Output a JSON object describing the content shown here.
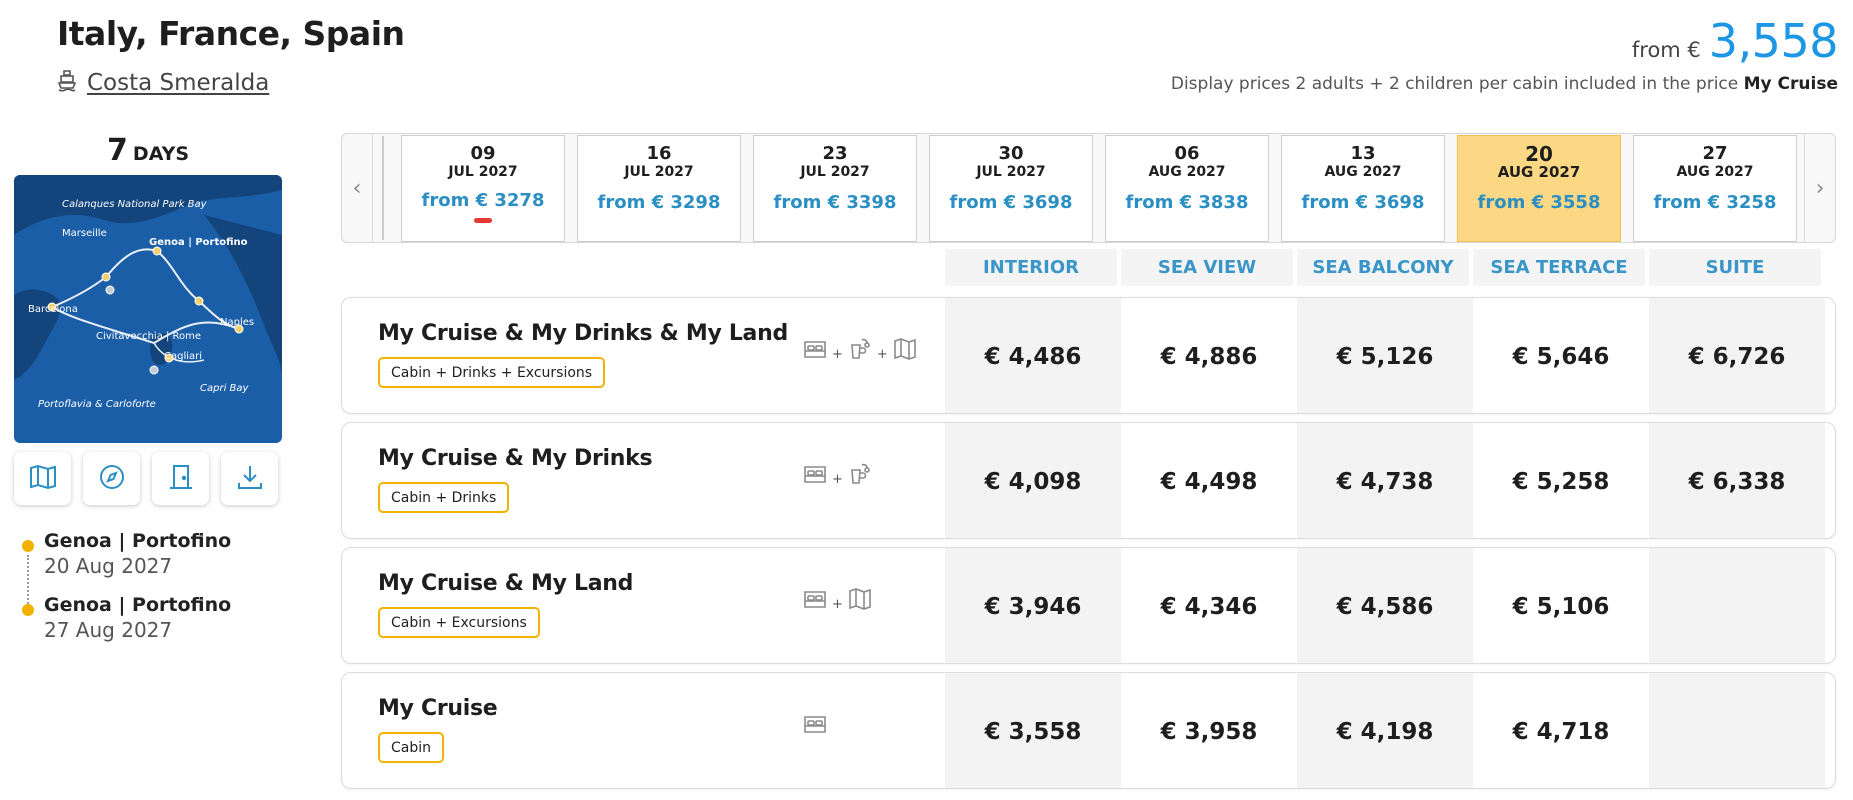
{
  "header": {
    "title": "Italy, France, Spain",
    "ship": "Costa Smeralda",
    "price_from_label": "from €",
    "price_value": "3,558",
    "display_note": "Display prices 2 adults + 2 children per cabin included in the price",
    "display_note_bold": "My Cruise"
  },
  "duration": {
    "number": "7",
    "unit": "DAYS"
  },
  "map": {
    "labels": [
      "Calanques National Park Bay",
      "Marseille",
      "Genoa | Portofino",
      "Barcelona",
      "Civitavecchia | Rome",
      "Naples",
      "Cagliari",
      "Capri Bay",
      "Portoflavia & Carloforte"
    ]
  },
  "map_tools": [
    {
      "name": "map-icon"
    },
    {
      "name": "compass-icon"
    },
    {
      "name": "door-icon"
    },
    {
      "name": "download-icon"
    }
  ],
  "itinerary": [
    {
      "port": "Genoa | Portofino",
      "date": "20 Aug 2027"
    },
    {
      "port": "Genoa | Portofino",
      "date": "27 Aug 2027"
    }
  ],
  "dates": [
    {
      "day": "09",
      "month": "JUL 2027",
      "price": "from € 3278",
      "selected": false,
      "marker": true
    },
    {
      "day": "16",
      "month": "JUL 2027",
      "price": "from € 3298",
      "selected": false,
      "marker": false
    },
    {
      "day": "23",
      "month": "JUL 2027",
      "price": "from € 3398",
      "selected": false,
      "marker": false
    },
    {
      "day": "30",
      "month": "JUL 2027",
      "price": "from € 3698",
      "selected": false,
      "marker": false
    },
    {
      "day": "06",
      "month": "AUG 2027",
      "price": "from € 3838",
      "selected": false,
      "marker": false
    },
    {
      "day": "13",
      "month": "AUG 2027",
      "price": "from € 3698",
      "selected": false,
      "marker": false
    },
    {
      "day": "20",
      "month": "AUG 2027",
      "price": "from € 3558",
      "selected": true,
      "marker": false
    },
    {
      "day": "27",
      "month": "AUG 2027",
      "price": "from € 3258",
      "selected": false,
      "marker": false
    }
  ],
  "cabin_types": [
    "INTERIOR",
    "SEA VIEW",
    "SEA BALCONY",
    "SEA TERRACE",
    "SUITE"
  ],
  "packages": [
    {
      "name": "My Cruise & My Drinks & My Land",
      "tag": "Cabin + Drinks + Excursions",
      "icons": [
        "bed-icon",
        "drinks-icon",
        "excursion-map-icon"
      ],
      "prices": [
        "€ 4,486",
        "€ 4,886",
        "€ 5,126",
        "€ 5,646",
        "€ 6,726"
      ]
    },
    {
      "name": "My Cruise & My Drinks",
      "tag": "Cabin + Drinks",
      "icons": [
        "bed-icon",
        "drinks-icon"
      ],
      "prices": [
        "€ 4,098",
        "€ 4,498",
        "€ 4,738",
        "€ 5,258",
        "€ 6,338"
      ]
    },
    {
      "name": "My Cruise & My Land",
      "tag": "Cabin + Excursions",
      "icons": [
        "bed-icon",
        "excursion-map-icon"
      ],
      "prices": [
        "€ 3,946",
        "€ 4,346",
        "€ 4,586",
        "€ 5,106",
        ""
      ]
    },
    {
      "name": "My Cruise",
      "tag": "Cabin",
      "icons": [
        "bed-icon"
      ],
      "prices": [
        "€ 3,558",
        "€ 3,958",
        "€ 4,198",
        "€ 4,718",
        ""
      ]
    }
  ],
  "colors": {
    "accent_blue": "#1e96e6",
    "price_blue": "#2b8fc4",
    "tag_yellow": "#f2b200",
    "selected_date": "#fcd884",
    "map_sea": "#1b5ea8"
  }
}
